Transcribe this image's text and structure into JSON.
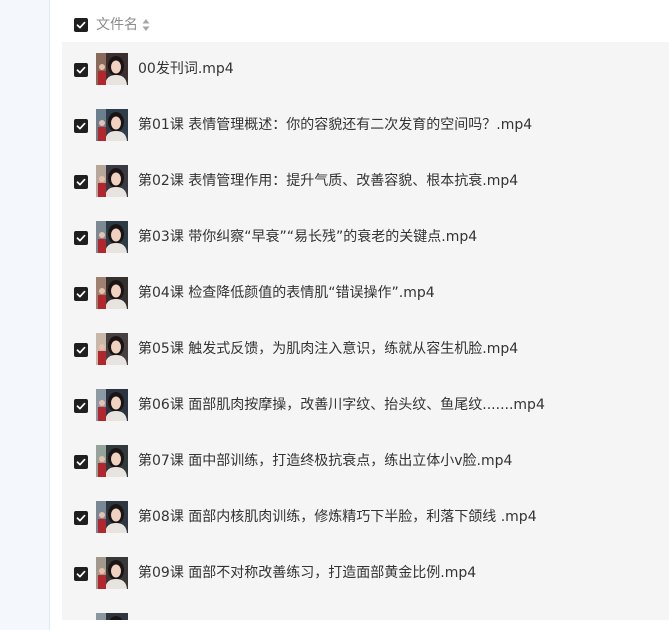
{
  "header": {
    "select_all_checked": true,
    "column_label": "文件名",
    "sort_icon": "sort-caret-icon"
  },
  "files": [
    {
      "name": "00发刊词.mp4",
      "checked": true
    },
    {
      "name": "第01课 表情管理概述：你的容貌还有二次发育的空间吗？.mp4",
      "checked": true
    },
    {
      "name": "第02课 表情管理作用：提升气质、改善容貌、根本抗衰.mp4",
      "checked": true
    },
    {
      "name": "第03课 带你纠察“早衰”“易长残”的衰老的关键点.mp4",
      "checked": true
    },
    {
      "name": "第04课 检查降低颜值的表情肌“错误操作”.mp4",
      "checked": true
    },
    {
      "name": "第05课 触发式反馈，为肌肉注入意识，练就从容生机脸.mp4",
      "checked": true
    },
    {
      "name": "第06课 面部肌肉按摩操，改善川字纹、抬头纹、鱼尾纹.......mp4",
      "checked": true
    },
    {
      "name": "第07课 面中部训练，打造终极抗衰点，练出立体小v脸.mp4",
      "checked": true
    },
    {
      "name": "第08课 面部内核肌肉训练，修炼精巧下半脸，利落下颌线 .mp4",
      "checked": true
    },
    {
      "name": "第09课 面部不对称改善练习，打造面部黄金比例.mp4",
      "checked": true
    },
    {
      "name": "",
      "checked": true
    }
  ]
}
